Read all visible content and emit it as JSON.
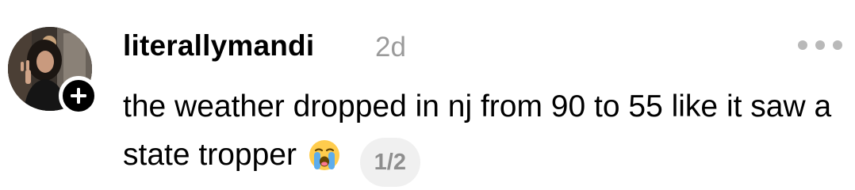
{
  "post": {
    "username": "literallymandi",
    "timestamp": "2d",
    "text": "the weather dropped in nj from 90 to 55 like it saw a state tropper",
    "emoji": "😭",
    "emoji_name": "loudly-crying-face-icon",
    "page_indicator": "1/2"
  },
  "icons": {
    "avatar": "profile-photo",
    "follow_badge": "plus-icon",
    "more": "more-dots-icon"
  },
  "colors": {
    "text": "#000000",
    "muted": "#9b9b9b",
    "pill_bg": "#f0f0f0",
    "badge_bg": "#000000"
  }
}
